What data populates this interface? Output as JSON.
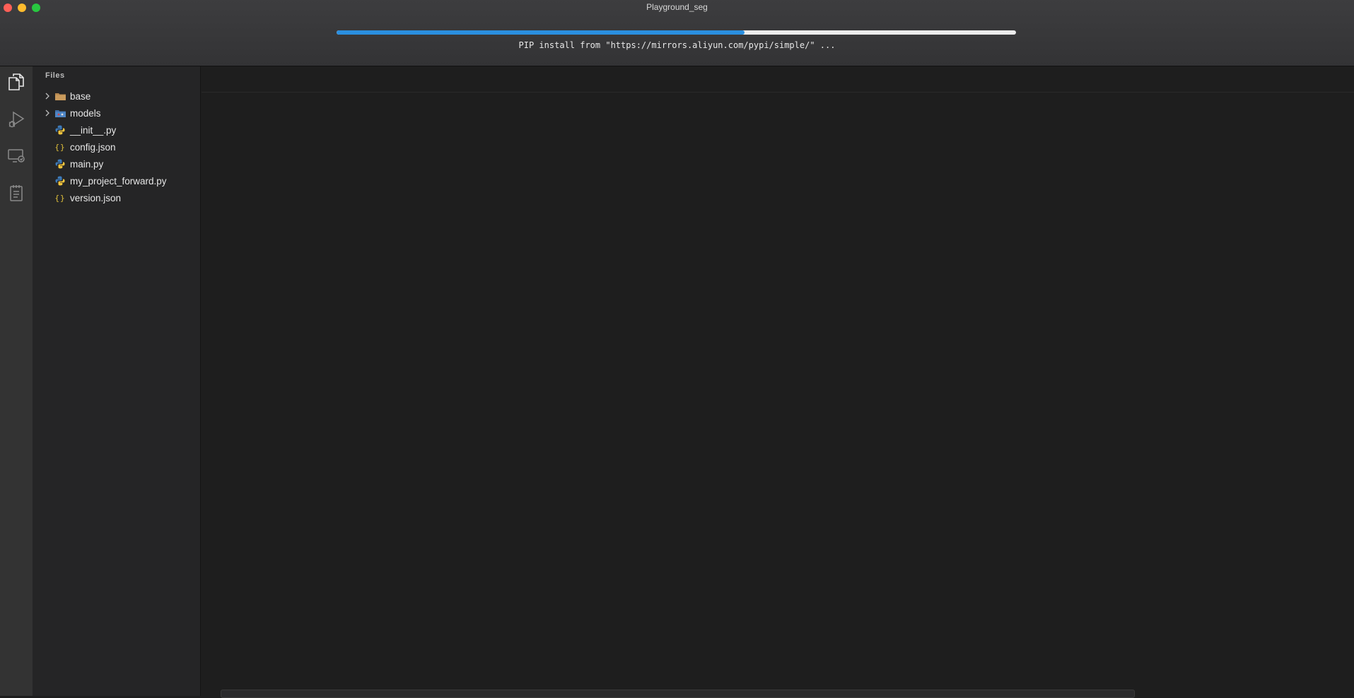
{
  "window": {
    "title": "Playground_seg"
  },
  "install": {
    "progress": 0.6,
    "message": "PIP install from \"https://mirrors.aliyun.com/pypi/simple/\" ..."
  },
  "activity_bar": {
    "items": [
      {
        "icon": "files-icon"
      },
      {
        "icon": "run-debug-icon"
      },
      {
        "icon": "remote-icon"
      },
      {
        "icon": "notes-icon"
      }
    ]
  },
  "sidebar": {
    "title": "Files",
    "items": [
      {
        "label": "base",
        "type": "folder",
        "icon": "folder-icon"
      },
      {
        "label": "models",
        "type": "folder",
        "icon": "models-folder-icon"
      },
      {
        "label": "__init__.py",
        "type": "file",
        "icon": "python-icon"
      },
      {
        "label": "config.json",
        "type": "file",
        "icon": "json-icon"
      },
      {
        "label": "main.py",
        "type": "file",
        "icon": "python-icon"
      },
      {
        "label": "my_project_forward.py",
        "type": "file",
        "icon": "python-icon"
      },
      {
        "label": "version.json",
        "type": "file",
        "icon": "json-icon"
      }
    ]
  },
  "colors": {
    "progress": "#2a8fe0",
    "background": "#1e1e1e",
    "sidebar": "#252526",
    "activity_bar": "#333333"
  }
}
